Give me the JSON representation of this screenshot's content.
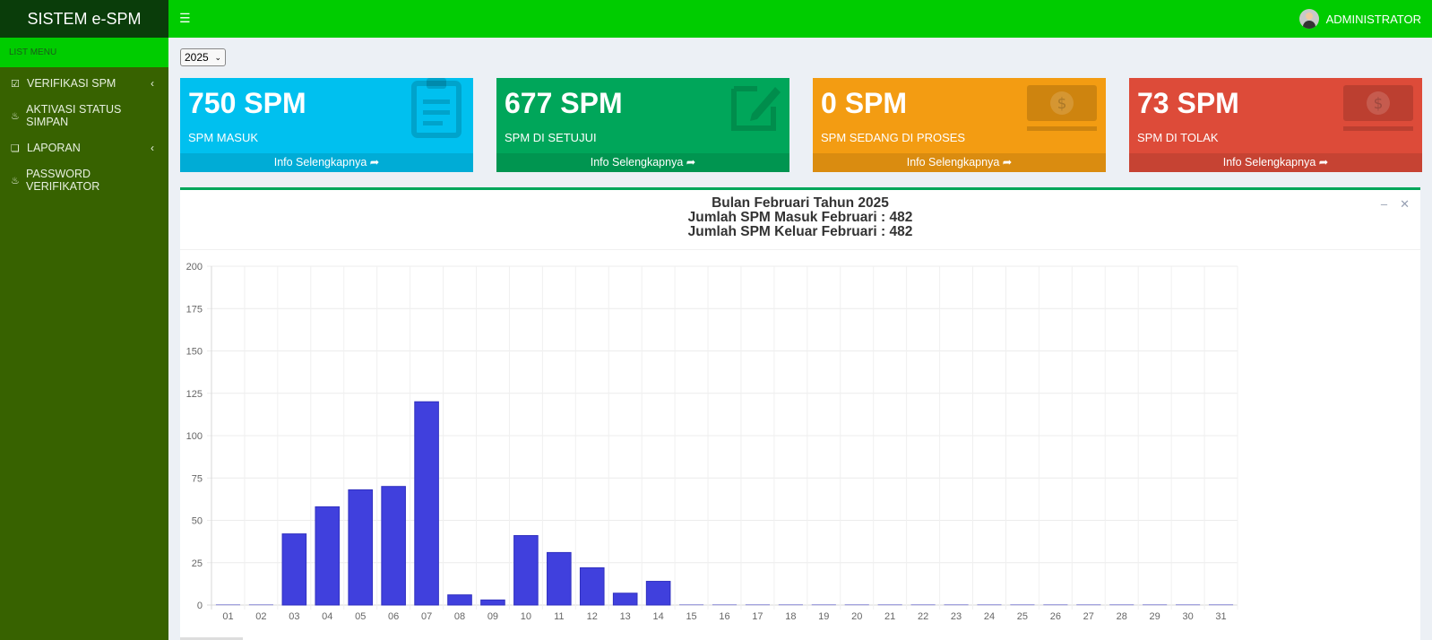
{
  "app": {
    "title": "SISTEM e-SPM",
    "menu_icon": "hamburger-icon"
  },
  "user": {
    "name": "ADMINISTRATOR"
  },
  "sidebar": {
    "header": "LIST MENU",
    "items": [
      {
        "label": "VERIFIKASI SPM",
        "icon": "check-square-icon",
        "has_submenu": true
      },
      {
        "label": "AKTIVASI STATUS SIMPAN",
        "icon": "fire-icon",
        "has_submenu": false
      },
      {
        "label": "LAPORAN",
        "icon": "copy-icon",
        "has_submenu": true
      },
      {
        "label": "PASSWORD VERIFIKATOR",
        "icon": "fire-icon",
        "has_submenu": false
      }
    ]
  },
  "filter": {
    "year": "2025"
  },
  "boxes": [
    {
      "value": "750 SPM",
      "label": "SPM MASUK",
      "link": "Info Selengkapnya",
      "color": "#00c0ef",
      "icon": "clipboard-icon"
    },
    {
      "value": "677 SPM",
      "label": "SPM DI SETUJUI",
      "link": "Info Selengkapnya",
      "color": "#00a65a",
      "icon": "edit-icon"
    },
    {
      "value": "0 SPM",
      "label": "SPM SEDANG DI PROSES",
      "link": "Info Selengkapnya",
      "color": "#f39c12",
      "icon": "money-icon"
    },
    {
      "value": "73 SPM",
      "label": "SPM DI TOLAK",
      "link": "Info Selengkapnya",
      "color": "#dd4b39",
      "icon": "money-icon"
    }
  ],
  "panel": {
    "title_line1": "Bulan Februari Tahun 2025",
    "title_line2": "Jumlah SPM Masuk Februari : 482",
    "title_line3": "Jumlah SPM Keluar Februari : 482"
  },
  "chart_data": {
    "type": "bar",
    "categories": [
      "01",
      "02",
      "03",
      "04",
      "05",
      "06",
      "07",
      "08",
      "09",
      "10",
      "11",
      "12",
      "13",
      "14",
      "15",
      "16",
      "17",
      "18",
      "19",
      "20",
      "21",
      "22",
      "23",
      "24",
      "25",
      "26",
      "27",
      "28",
      "29",
      "30",
      "31"
    ],
    "values": [
      0,
      0,
      42,
      58,
      68,
      70,
      120,
      6,
      3,
      41,
      31,
      22,
      7,
      14,
      0,
      0,
      0,
      0,
      0,
      0,
      0,
      0,
      0,
      0,
      0,
      0,
      0,
      0,
      0,
      0,
      0
    ],
    "yticks": [
      0,
      25,
      50,
      75,
      100,
      125,
      150,
      175,
      200
    ],
    "ylim": [
      0,
      200
    ],
    "bar_color": "#4040dd",
    "grid": true
  }
}
